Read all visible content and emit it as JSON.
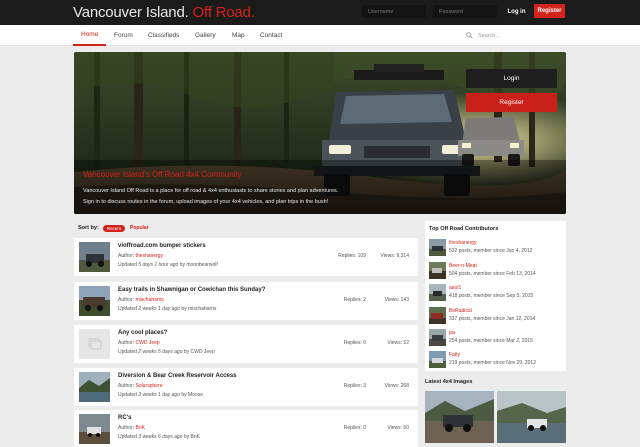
{
  "brand": {
    "name": "Vancouver Island.",
    "accent": "Off Road."
  },
  "topbar": {
    "username_placeholder": "Username",
    "password_placeholder": "Password",
    "login_label": "Log in",
    "register_label": "Register"
  },
  "nav": {
    "items": [
      {
        "label": "Home"
      },
      {
        "label": "Forum"
      },
      {
        "label": "Classifieds"
      },
      {
        "label": "Gallery"
      },
      {
        "label": "Map"
      },
      {
        "label": "Contact"
      }
    ],
    "search_placeholder": "Search..."
  },
  "hero": {
    "title": "Vancouver Island's Off Road 4x4 Community",
    "line1": "Vancouver Island Off Road is a place for off road & 4x4 enthusiasts to share stories and plan adventures.",
    "line2": "Sign in to discuss routes in the forum, upload images of your 4x4 vehicles, and plan trips in the bush!",
    "login_label": "Login",
    "register_label": "Register"
  },
  "sort": {
    "label": "Sort by:",
    "recent": "Recent",
    "popular": "Popular"
  },
  "threads": [
    {
      "title": "vioffroad.com bumper stickers",
      "author_prefix": "Author:",
      "author": "theshanergy",
      "updated_prefix": "Updated",
      "updated_time": "5 days 1 hour ago",
      "updated_by": "by moonbearwolf",
      "replies": "Replies: 109",
      "views": "Views: 9,314"
    },
    {
      "title": "Easy trails in Shawnigan or Cowichan this Sunday?",
      "author_prefix": "Author:",
      "author": "mischaharris",
      "updated_prefix": "Updated",
      "updated_time": "2 weeks 1 day ago",
      "updated_by": "by mischaharris",
      "replies": "Replies: 2",
      "views": "Views: 143"
    },
    {
      "title": "Any cool places?",
      "author_prefix": "Author:",
      "author": "CWD Jeep",
      "updated_prefix": "Updated",
      "updated_time": "2 weeks 5 days ago",
      "updated_by": "by CWD Jeep",
      "replies": "Replies: 0",
      "views": "Views: 52"
    },
    {
      "title": "Diversion & Bear Creek Reservoir Access",
      "author_prefix": "Author:",
      "author": "Solarsphere",
      "updated_prefix": "Updated",
      "updated_time": "3 weeks 1 day ago",
      "updated_by": "by Moose",
      "replies": "Replies: 3",
      "views": "Views: 268"
    },
    {
      "title": "RC's",
      "author_prefix": "Author:",
      "author": "BnK",
      "updated_prefix": "Updated",
      "updated_time": "3 weeks 6 days ago",
      "updated_by": "by BnK",
      "replies": "Replies: 0",
      "views": "Views: 60"
    }
  ],
  "contributors": {
    "title": "Top Off Road Contributors",
    "items": [
      {
        "name": "theshanergy",
        "meta": "532 posts, member since Jun 4, 2012"
      },
      {
        "name": "Beer-n-Meat",
        "meta": "504 posts, member since Feb 13, 2014"
      },
      {
        "name": "aaoi1",
        "meta": "418 posts, member since Sep 5, 2015"
      },
      {
        "name": "BeRadical",
        "meta": "337 posts, member since Jan 12, 2014"
      },
      {
        "name": "jas",
        "meta": "254 posts, member since Mar 2, 2015"
      },
      {
        "name": "Fatty",
        "meta": "219 posts, member since Nov 29, 2012"
      }
    ]
  },
  "latest_images": {
    "title": "Latest 4x4 Images"
  },
  "colors": {
    "accent": "#d4231c",
    "topbar": "#1b1b1b",
    "background": "#ececec"
  }
}
